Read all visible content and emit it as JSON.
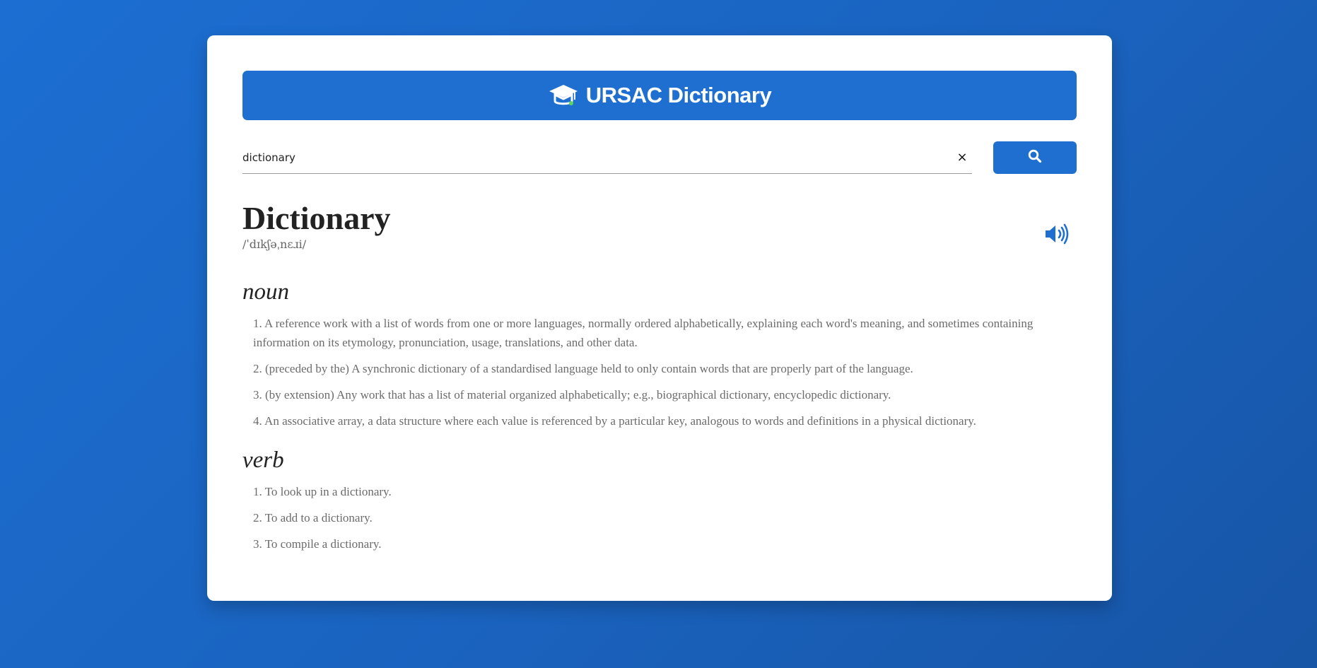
{
  "header": {
    "logo_icon": "graduation-cap-icon",
    "title": "URSAC Dictionary",
    "color": "#1f6fd1"
  },
  "search": {
    "value": "dictionary",
    "placeholder": "",
    "clear_icon": "close-icon",
    "clear_label": "×",
    "button_icon": "search-icon"
  },
  "entry": {
    "word": "Dictionary",
    "phonetic": "/ˈdɪkʃəˌnɛɹi/",
    "audio_icon": "speaker-icon",
    "meanings": [
      {
        "part_of_speech": "noun",
        "definitions": [
          "1. A reference work with a list of words from one or more languages, normally ordered alphabetically, explaining each word's meaning, and sometimes containing information on its etymology, pronunciation, usage, translations, and other data.",
          "2. (preceded by the) A synchronic dictionary of a standardised language held to only contain words that are properly part of the language.",
          "3. (by extension) Any work that has a list of material organized alphabetically; e.g., biographical dictionary, encyclopedic dictionary.",
          "4. An associative array, a data structure where each value is referenced by a particular key, analogous to words and definitions in a physical dictionary."
        ]
      },
      {
        "part_of_speech": "verb",
        "definitions": [
          "1. To look up in a dictionary.",
          "2. To add to a dictionary.",
          "3. To compile a dictionary."
        ]
      }
    ]
  }
}
